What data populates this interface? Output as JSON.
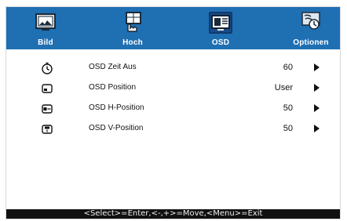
{
  "tabs": [
    {
      "label": "Bild",
      "icon": "picture-icon",
      "active": false
    },
    {
      "label": "Hoch",
      "icon": "hand-layout-icon",
      "active": false
    },
    {
      "label": "OSD",
      "icon": "osd-icon",
      "active": true
    },
    {
      "label": "Optionen",
      "icon": "options-hand-icon",
      "active": false
    }
  ],
  "menu": {
    "items": [
      {
        "label": "OSD Zeit Aus",
        "value": "60",
        "icon": "timer-icon"
      },
      {
        "label": "OSD Position",
        "value": "User",
        "icon": "screen-position-icon"
      },
      {
        "label": "OSD H-Position",
        "value": "50",
        "icon": "horizontal-position-icon"
      },
      {
        "label": "OSD V-Position",
        "value": "50",
        "icon": "vertical-position-icon"
      }
    ]
  },
  "footer": {
    "hint": "<Select>=Enter,<-,+>=Move,<Menu>=Exit"
  },
  "colors": {
    "tab_bar": "#1f6fb3",
    "active_tab": "#1a4b86",
    "footer_bg": "#111111",
    "text": "#111111"
  }
}
